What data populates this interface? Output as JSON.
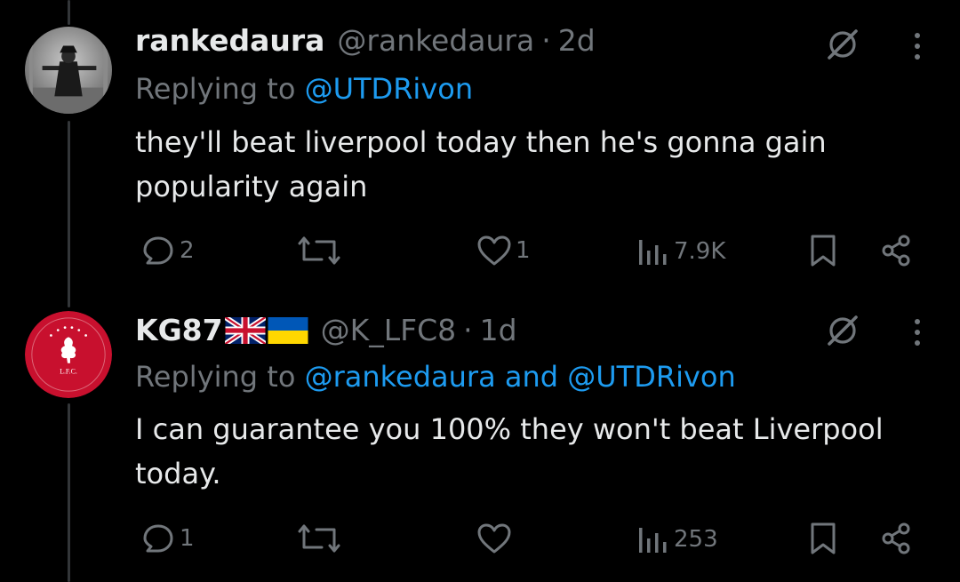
{
  "tweets": [
    {
      "name": "rankedaura",
      "handle": "@rankedaura",
      "separator": "·",
      "time": "2d",
      "replying_prefix": "Replying to",
      "mentions": [
        "@UTDRivon"
      ],
      "mention_joiner": "",
      "text": "they'll beat liverpool today then he's gonna gain popularity again",
      "stats": {
        "replies": "2",
        "retweets": "",
        "likes": "1",
        "views": "7.9K"
      },
      "avatar_icon": "scarecrow-photo-avatar",
      "flags": []
    },
    {
      "name": "KG87",
      "handle": "@K_LFC8",
      "separator": "·",
      "time": "1d",
      "replying_prefix": "Replying to",
      "mentions": [
        "@rankedaura",
        "@UTDRivon"
      ],
      "mention_joiner": "and",
      "text": "I can guarantee you 100% they won't beat Liverpool today.",
      "stats": {
        "replies": "1",
        "retweets": "",
        "likes": "",
        "views": "253"
      },
      "avatar_icon": "lfc-crest-avatar",
      "avatar_text": "L.F.C.",
      "flags": [
        "uk-flag",
        "ukraine-flag"
      ]
    }
  ],
  "colors": {
    "background": "#000000",
    "text": "#e7e9ea",
    "muted": "#71767b",
    "link": "#1d9bf0",
    "lfc_red": "#c8102e"
  }
}
